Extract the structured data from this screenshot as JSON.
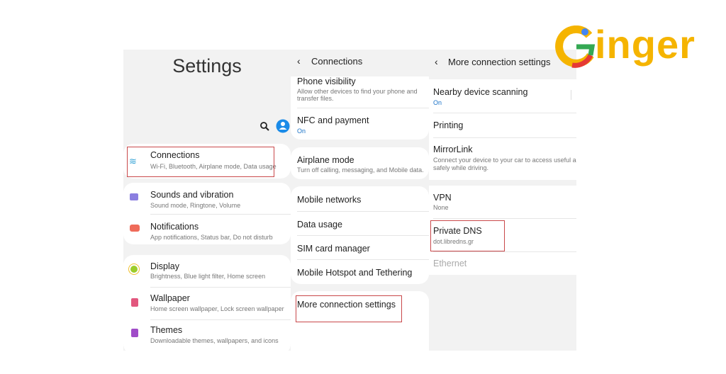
{
  "logo": {
    "text": "Ginger",
    "colors": {
      "yellow": "#f5b400",
      "red": "#e53935",
      "green": "#34a853",
      "blue": "#4285f4"
    }
  },
  "settings": {
    "title": "Settings",
    "items": [
      {
        "icon": "wifi-icon",
        "label": "Connections",
        "sub": "Wi-Fi, Bluetooth, Airplane mode, Data usage"
      },
      {
        "icon": "volume-icon",
        "label": "Sounds and vibration",
        "sub": "Sound mode, Ringtone, Volume"
      },
      {
        "icon": "notification-icon",
        "label": "Notifications",
        "sub": "App notifications, Status bar, Do not disturb"
      },
      {
        "icon": "brightness-icon",
        "label": "Display",
        "sub": "Brightness, Blue light filter, Home screen"
      },
      {
        "icon": "wallpaper-icon",
        "label": "Wallpaper",
        "sub": "Home screen wallpaper, Lock screen wallpaper"
      },
      {
        "icon": "themes-icon",
        "label": "Themes",
        "sub": "Downloadable themes, wallpapers, and icons"
      }
    ]
  },
  "connections": {
    "title": "Connections",
    "items": [
      {
        "label": "Phone visibility",
        "sub": "Allow other devices to find your phone and transfer files."
      },
      {
        "label": "NFC and payment",
        "sub": "On"
      },
      {
        "label": "Airplane mode",
        "sub": "Turn off calling, messaging, and Mobile data."
      },
      {
        "label": "Mobile networks"
      },
      {
        "label": "Data usage"
      },
      {
        "label": "SIM card manager"
      },
      {
        "label": "Mobile Hotspot and Tethering"
      },
      {
        "label": "More connection settings"
      }
    ]
  },
  "more": {
    "title": "More connection settings",
    "items": [
      {
        "label": "Nearby device scanning",
        "sub": "On"
      },
      {
        "label": "Printing"
      },
      {
        "label": "MirrorLink",
        "sub": "Connect your device to your car to access useful a",
        "sub2": "safely while driving."
      },
      {
        "label": "VPN",
        "sub": "None"
      },
      {
        "label": "Private DNS",
        "sub": "dot.libredns.gr"
      },
      {
        "label": "Ethernet"
      }
    ]
  },
  "accent": "#1a73c8",
  "highlight": "#c9484a"
}
